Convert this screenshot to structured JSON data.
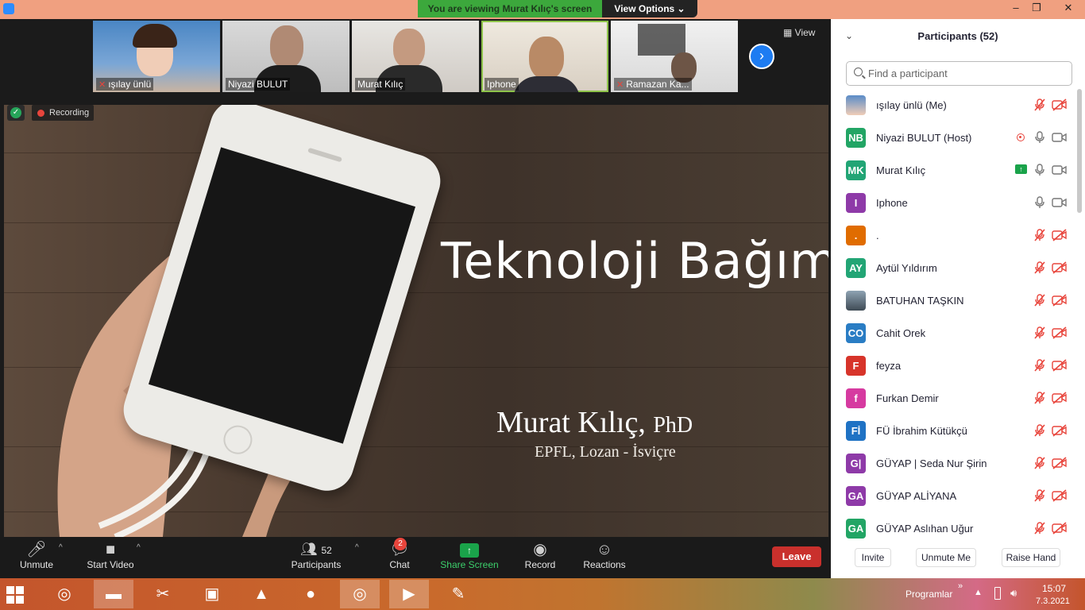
{
  "titlebar": {
    "banner": "You are viewing Murat Kılıç's screen",
    "view_options": "View Options ⌄",
    "minimize": "–",
    "maximize": "❐",
    "close": "✕"
  },
  "thumbnails": [
    {
      "name": "ışılay ünlü",
      "muted": true
    },
    {
      "name": "Niyazi BULUT",
      "muted": false
    },
    {
      "name": "Murat Kılıç",
      "muted": false
    },
    {
      "name": "Iphone",
      "muted": false,
      "active": true
    },
    {
      "name": "Ramazan Ka...",
      "muted": true
    }
  ],
  "view_button": "View",
  "recording_label": "Recording",
  "slide": {
    "title": "Teknoloji Bağımlılığı",
    "author": "Murat Kılıç,",
    "degree": "PhD",
    "affiliation": "EPFL, Lozan - İsviçre"
  },
  "toolbar": {
    "unmute": "Unmute",
    "start_video": "Start Video",
    "participants": "Participants",
    "participants_count": "52",
    "chat": "Chat",
    "chat_badge": "2",
    "share_screen": "Share Screen",
    "record": "Record",
    "reactions": "Reactions",
    "leave": "Leave"
  },
  "panel": {
    "title": "Participants (52)",
    "search_placeholder": "Find a participant",
    "participants": [
      {
        "name": "ışılay ünlü (Me)",
        "initials": "",
        "color": "#c8a88a",
        "mic": "muted",
        "cam": "off"
      },
      {
        "name": "Niyazi BULUT (Host)",
        "initials": "NB",
        "color": "#22a565",
        "mic": "on",
        "cam": "on",
        "recording": true
      },
      {
        "name": "Murat Kılıç",
        "initials": "MK",
        "color": "#22a575",
        "mic": "on",
        "cam": "on",
        "sharing": true
      },
      {
        "name": "Iphone",
        "initials": "I",
        "color": "#8e3aa8",
        "mic": "on",
        "cam": "on"
      },
      {
        "name": ".",
        "initials": ".",
        "color": "#e06c00",
        "mic": "muted",
        "cam": "off"
      },
      {
        "name": "Aytül Yıldırım",
        "initials": "AY",
        "color": "#22a575",
        "mic": "muted",
        "cam": "off"
      },
      {
        "name": "BATUHAN TAŞKIN",
        "initials": "",
        "color": "#5a6a7a",
        "mic": "muted",
        "cam": "off"
      },
      {
        "name": "Cahit Orek",
        "initials": "CO",
        "color": "#2a7dc4",
        "mic": "muted",
        "cam": "off"
      },
      {
        "name": "feyza",
        "initials": "F",
        "color": "#d7342a",
        "mic": "muted",
        "cam": "off"
      },
      {
        "name": "Furkan Demir",
        "initials": "f",
        "color": "#d63aa0",
        "mic": "muted",
        "cam": "off"
      },
      {
        "name": "FÜ İbrahim Kütükçü",
        "initials": "Fİ",
        "color": "#1f72c4",
        "mic": "muted",
        "cam": "off"
      },
      {
        "name": "GÜYAP | Seda Nur Şirin",
        "initials": "G|",
        "color": "#8e3aa8",
        "mic": "muted",
        "cam": "off"
      },
      {
        "name": "GÜYAP ALİYANA",
        "initials": "GA",
        "color": "#8e3aa8",
        "mic": "muted",
        "cam": "off"
      },
      {
        "name": "GÜYAP Aslıhan Uğur",
        "initials": "GA",
        "color": "#22a565",
        "mic": "muted",
        "cam": "off"
      }
    ],
    "invite": "Invite",
    "unmute_me": "Unmute Me",
    "raise_hand": "Raise Hand"
  },
  "taskbar": {
    "tray_label": "Programlar",
    "tray_chevron": "»",
    "time": "15:07",
    "date": "7.3.2021"
  }
}
